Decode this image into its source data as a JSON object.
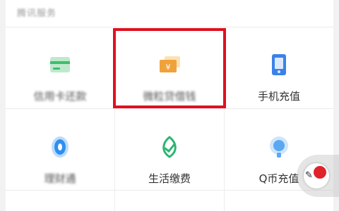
{
  "section": {
    "title": "腾讯服务"
  },
  "services": [
    {
      "label": "信用卡还款",
      "icon": "card-icon",
      "color": "#3cbf6a"
    },
    {
      "label": "微粒贷借钱",
      "icon": "yuan-wallet-icon",
      "color": "#f0a23a"
    },
    {
      "label": "手机充值",
      "icon": "phone-icon",
      "color": "#3b82e8"
    },
    {
      "label": "理财通",
      "icon": "wealth-icon",
      "color": "#2f8ff0"
    },
    {
      "label": "生活缴费",
      "icon": "life-payment-icon",
      "color": "#2bb673"
    },
    {
      "label": "Q币充值",
      "icon": "qcoin-icon",
      "color": "#5aa8f2"
    }
  ]
}
